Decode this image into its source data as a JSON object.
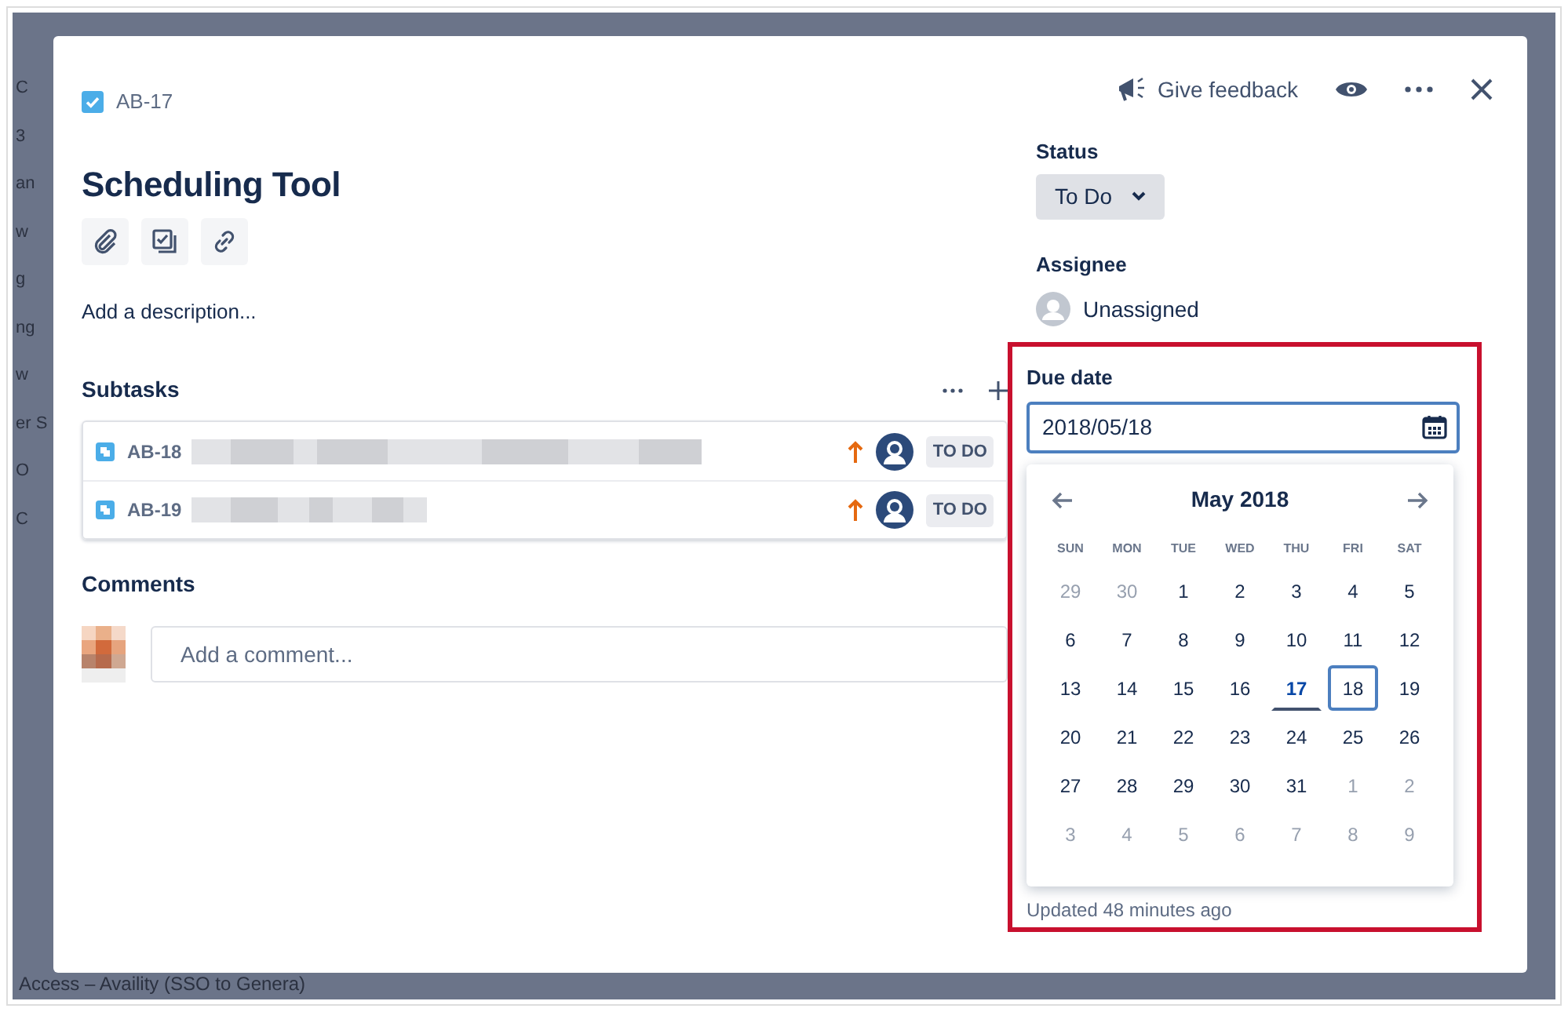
{
  "backdrop": {
    "fragments": [
      "C",
      "3",
      "an",
      "w",
      "g",
      "ng",
      "w",
      "er S",
      "O",
      "C"
    ],
    "footer_text": "Access – Availity (SSO to Genera)"
  },
  "issue": {
    "key": "AB-17",
    "title": "Scheduling Tool",
    "description": "Add a description..."
  },
  "header": {
    "feedback": "Give feedback"
  },
  "subtasks": {
    "title": "Subtasks",
    "items": [
      {
        "key": "AB-18",
        "status": "TO DO"
      },
      {
        "key": "AB-19",
        "status": "TO DO"
      }
    ]
  },
  "comments": {
    "title": "Comments",
    "placeholder": "Add a comment..."
  },
  "status": {
    "label": "Status",
    "value": "To Do"
  },
  "assignee": {
    "label": "Assignee",
    "value": "Unassigned"
  },
  "due_date": {
    "label": "Due date",
    "value": "2018/05/18",
    "updated": "Updated 48 minutes ago",
    "calendar": {
      "month": "May 2018",
      "weekdays": [
        "SUN",
        "MON",
        "TUE",
        "WED",
        "THU",
        "FRI",
        "SAT"
      ],
      "weeks": [
        [
          {
            "d": "29",
            "muted": true,
            "today": false,
            "selected": false
          },
          {
            "d": "30",
            "muted": true,
            "today": false,
            "selected": false
          },
          {
            "d": "1",
            "muted": false,
            "today": false,
            "selected": false
          },
          {
            "d": "2",
            "muted": false,
            "today": false,
            "selected": false
          },
          {
            "d": "3",
            "muted": false,
            "today": false,
            "selected": false
          },
          {
            "d": "4",
            "muted": false,
            "today": false,
            "selected": false
          },
          {
            "d": "5",
            "muted": false,
            "today": false,
            "selected": false
          }
        ],
        [
          {
            "d": "6",
            "muted": false,
            "today": false,
            "selected": false
          },
          {
            "d": "7",
            "muted": false,
            "today": false,
            "selected": false
          },
          {
            "d": "8",
            "muted": false,
            "today": false,
            "selected": false
          },
          {
            "d": "9",
            "muted": false,
            "today": false,
            "selected": false
          },
          {
            "d": "10",
            "muted": false,
            "today": false,
            "selected": false
          },
          {
            "d": "11",
            "muted": false,
            "today": false,
            "selected": false
          },
          {
            "d": "12",
            "muted": false,
            "today": false,
            "selected": false
          }
        ],
        [
          {
            "d": "13",
            "muted": false,
            "today": false,
            "selected": false
          },
          {
            "d": "14",
            "muted": false,
            "today": false,
            "selected": false
          },
          {
            "d": "15",
            "muted": false,
            "today": false,
            "selected": false
          },
          {
            "d": "16",
            "muted": false,
            "today": false,
            "selected": false
          },
          {
            "d": "17",
            "muted": false,
            "today": true,
            "selected": false
          },
          {
            "d": "18",
            "muted": false,
            "today": false,
            "selected": true
          },
          {
            "d": "19",
            "muted": false,
            "today": false,
            "selected": false
          }
        ],
        [
          {
            "d": "20",
            "muted": false,
            "today": false,
            "selected": false
          },
          {
            "d": "21",
            "muted": false,
            "today": false,
            "selected": false
          },
          {
            "d": "22",
            "muted": false,
            "today": false,
            "selected": false
          },
          {
            "d": "23",
            "muted": false,
            "today": false,
            "selected": false
          },
          {
            "d": "24",
            "muted": false,
            "today": false,
            "selected": false
          },
          {
            "d": "25",
            "muted": false,
            "today": false,
            "selected": false
          },
          {
            "d": "26",
            "muted": false,
            "today": false,
            "selected": false
          }
        ],
        [
          {
            "d": "27",
            "muted": false,
            "today": false,
            "selected": false
          },
          {
            "d": "28",
            "muted": false,
            "today": false,
            "selected": false
          },
          {
            "d": "29",
            "muted": false,
            "today": false,
            "selected": false
          },
          {
            "d": "30",
            "muted": false,
            "today": false,
            "selected": false
          },
          {
            "d": "31",
            "muted": false,
            "today": false,
            "selected": false
          },
          {
            "d": "1",
            "muted": true,
            "today": false,
            "selected": false
          },
          {
            "d": "2",
            "muted": true,
            "today": false,
            "selected": false
          }
        ],
        [
          {
            "d": "3",
            "muted": true,
            "today": false,
            "selected": false
          },
          {
            "d": "4",
            "muted": true,
            "today": false,
            "selected": false
          },
          {
            "d": "5",
            "muted": true,
            "today": false,
            "selected": false
          },
          {
            "d": "6",
            "muted": true,
            "today": false,
            "selected": false
          },
          {
            "d": "7",
            "muted": true,
            "today": false,
            "selected": false
          },
          {
            "d": "8",
            "muted": true,
            "today": false,
            "selected": false
          },
          {
            "d": "9",
            "muted": true,
            "today": false,
            "selected": false
          }
        ]
      ]
    }
  }
}
